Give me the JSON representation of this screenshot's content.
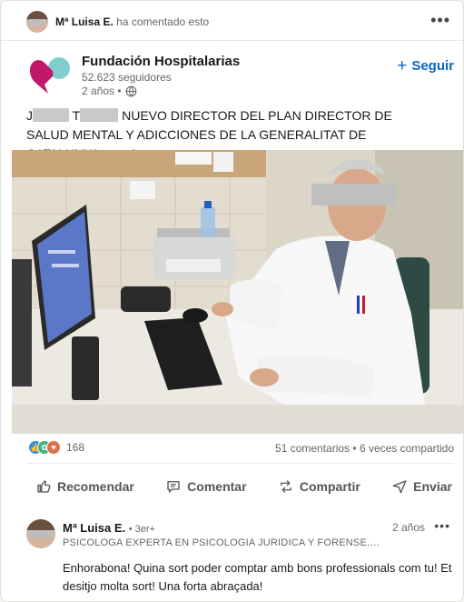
{
  "context": {
    "author": "Mª Luisa E.",
    "action": "ha comentado esto"
  },
  "actor": {
    "name": "Fundación Hospitalarias",
    "followers": "52.623 seguidores",
    "time": "2 años •",
    "follow_label": "Seguir",
    "follow_icon": "+",
    "logo_colors": {
      "magenta": "#c2186b",
      "teal": "#7fd0cc"
    }
  },
  "post": {
    "text_initial_1": "J",
    "text_initial_2": "T",
    "text_main": "NUEVO DIRECTOR DEL PLAN DIRECTOR DE SALUD MENTAL Y ADICCIONES DE LA GENERALITAT DE CATALUNYA",
    "see_more": "… más"
  },
  "social": {
    "reaction_count": "168",
    "comments": "51 comentarios",
    "separator": " • ",
    "shares": "6 veces compartido",
    "reaction_icons": [
      "like-icon",
      "celebrate-icon",
      "love-icon"
    ]
  },
  "actions": {
    "like": "Recomendar",
    "comment": "Comentar",
    "repost": "Compartir",
    "send": "Enviar"
  },
  "comment": {
    "author": "Mª Luisa E.",
    "degree": "• 3er+",
    "headline": "PSICOLOGA EXPERTA EN PSICOLOGIA JURIDICA Y FORENSE. PERITO JUDICIAL.",
    "time": "2 años",
    "body": "Enhorabona! Quina sort poder comptar amb bons professionals com tu! Et desitjo molta sort! Una forta abraçada!"
  },
  "colors": {
    "accent": "#0a66c2",
    "text_secondary": "#666666"
  }
}
